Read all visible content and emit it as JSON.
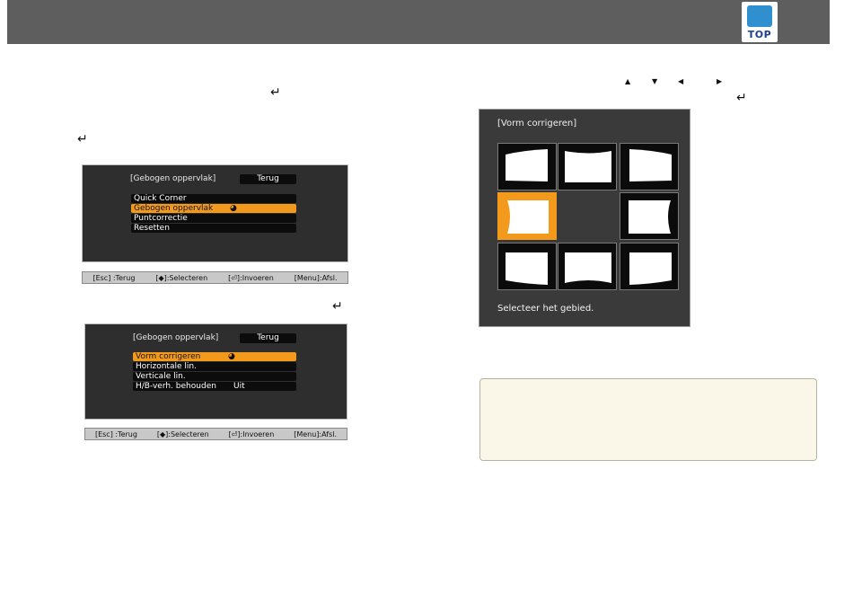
{
  "header": {
    "top_badge_label": "TOP"
  },
  "menu1": {
    "title": "[Gebogen oppervlak]",
    "back_label": "Terug",
    "items": [
      {
        "label": "Quick Corner"
      },
      {
        "label": "Gebogen oppervlak"
      },
      {
        "label": "Puntcorrectie"
      },
      {
        "label": "Resetten"
      }
    ],
    "hints": [
      "[Esc] :Terug",
      "[◆]:Selecteren",
      "[⏎]:Invoeren",
      "[Menu]:Afsl."
    ]
  },
  "menu2": {
    "title": "[Gebogen oppervlak]",
    "back_label": "Terug",
    "items": [
      {
        "label": "Vorm corrigeren",
        "value": ""
      },
      {
        "label": "Horizontale lin.",
        "value": ""
      },
      {
        "label": "Verticale lin.",
        "value": ""
      },
      {
        "label": "H/B-verh. behouden",
        "value": "Uit"
      }
    ],
    "hints": [
      "[Esc] :Terug",
      "[◆]:Selecteren",
      "[⏎]:Invoeren",
      "[Menu]:Afsl."
    ]
  },
  "shape_screen": {
    "title": "[Vorm corrigeren]",
    "status": "Selecteer het gebied.",
    "selected_cell": "middle-left"
  },
  "icons": {
    "return": "return-icon",
    "arrow_up": "arrow-up-icon",
    "arrow_down": "arrow-down-icon",
    "arrow_left": "arrow-left-icon",
    "arrow_right": "arrow-right-icon"
  },
  "colors": {
    "header_bg": "#5e5e5e",
    "menu_bg": "#2e2e2e",
    "highlight": "#f39a1d",
    "note_bg": "#fbf7e8"
  }
}
